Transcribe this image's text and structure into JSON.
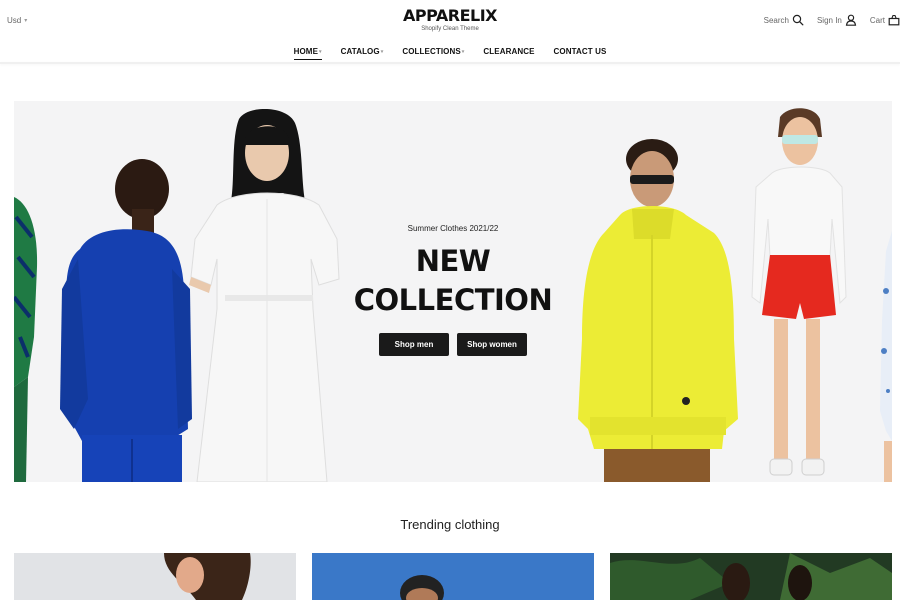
{
  "header": {
    "currency": "Usd",
    "logo_name": "APPARELIX",
    "logo_tagline": "Shopify Clean Theme",
    "search_label": "Search",
    "signin_label": "Sign In",
    "cart_label": "Cart"
  },
  "nav": {
    "items": [
      {
        "label": "HOME",
        "dropdown": true,
        "active": true
      },
      {
        "label": "CATALOG",
        "dropdown": true
      },
      {
        "label": "COLLECTIONS",
        "dropdown": true
      },
      {
        "label": "CLEARANCE",
        "dropdown": false
      },
      {
        "label": "CONTACT US",
        "dropdown": false
      }
    ]
  },
  "hero": {
    "subtitle": "Summer Clothes 2021/22",
    "title_line1": "NEW",
    "title_line2": "COLLECTION",
    "shop_men_label": "Shop men",
    "shop_women_label": "Shop women"
  },
  "trending": {
    "title": "Trending clothing"
  },
  "colors": {
    "hero_bg": "#f4f4f5",
    "button_bg": "#1a1a1a",
    "blue_suit": "#1540b0",
    "yellow_jacket": "#ecec35",
    "red_shorts": "#e5291f"
  }
}
